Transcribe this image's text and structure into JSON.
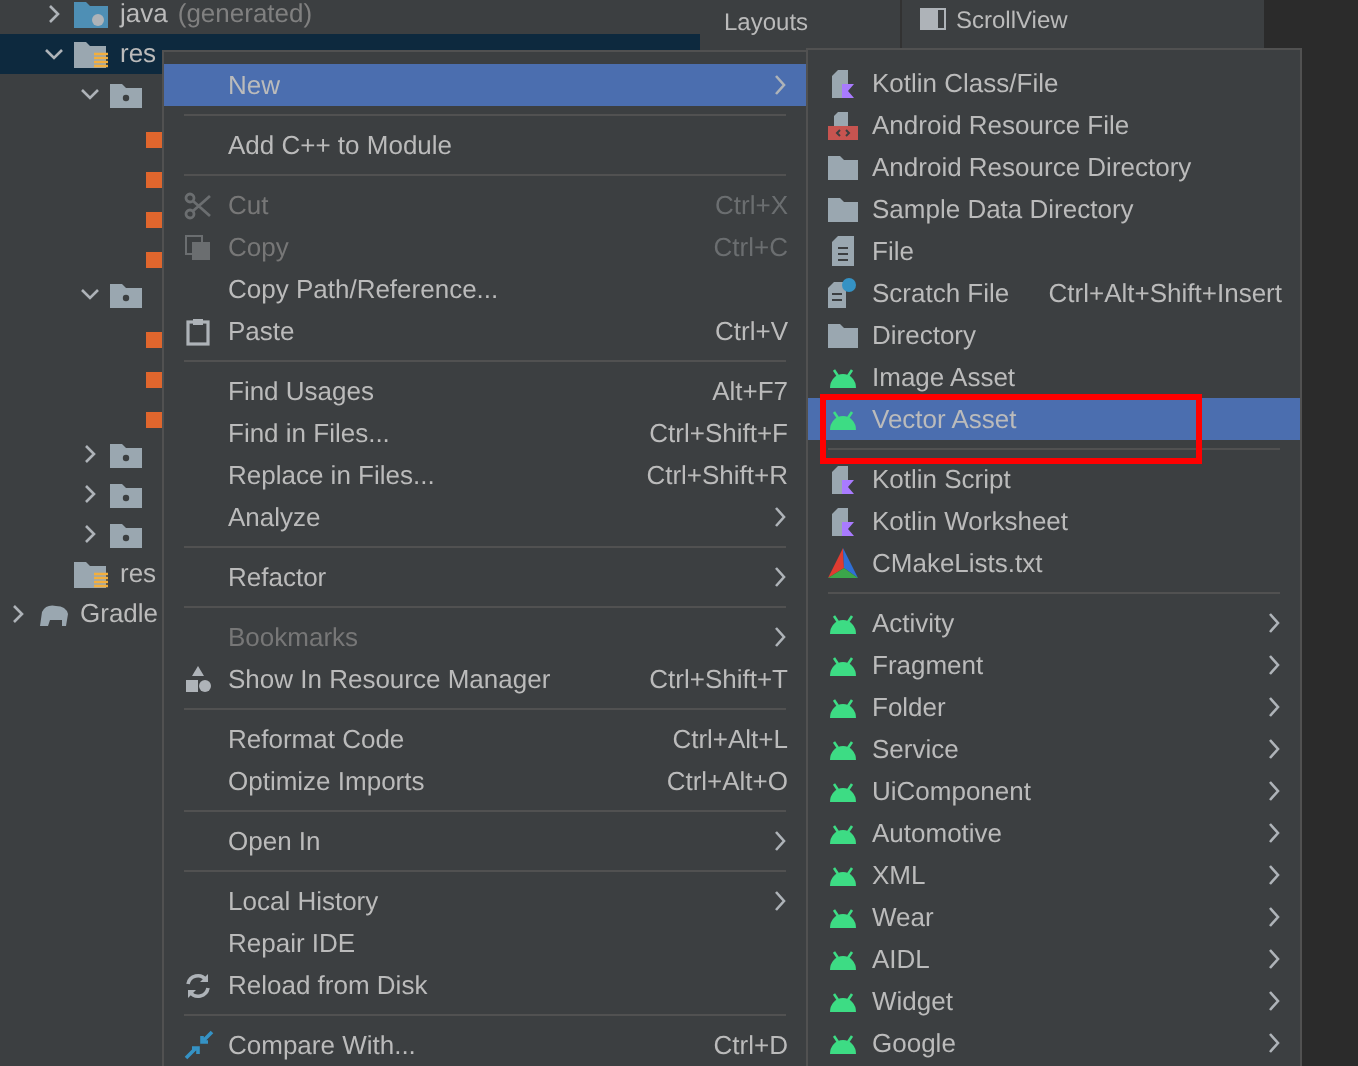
{
  "project_tree": {
    "items": [
      {
        "kind": "generated",
        "label": "java",
        "note": "(generated)",
        "expanded": false,
        "selected": false
      },
      {
        "kind": "res",
        "label": "res",
        "expanded": true,
        "selected": true,
        "children": [
          {
            "kind": "folder",
            "expanded": true,
            "selected": false,
            "children": [
              {
                "kind": "file",
                "selected": false
              },
              {
                "kind": "file",
                "selected": false
              },
              {
                "kind": "file",
                "selected": false
              },
              {
                "kind": "file",
                "selected": false
              }
            ]
          },
          {
            "kind": "folder",
            "expanded": true,
            "selected": false,
            "children": [
              {
                "kind": "file",
                "selected": false
              },
              {
                "kind": "file",
                "selected": false
              },
              {
                "kind": "file",
                "selected": false
              }
            ]
          },
          {
            "kind": "folder",
            "expanded": false,
            "selected": false
          },
          {
            "kind": "folder",
            "expanded": false,
            "selected": false
          },
          {
            "kind": "folder",
            "expanded": false,
            "selected": false
          }
        ]
      },
      {
        "kind": "res",
        "label": "res",
        "selected": false
      },
      {
        "kind": "gradle",
        "label": "Gradle",
        "expanded": false,
        "selected": false
      }
    ]
  },
  "palette": {
    "category": "Layouts",
    "item": "ScrollView"
  },
  "context_menu": {
    "groups": [
      [
        {
          "label": "New",
          "selected": true,
          "submenu": true,
          "disabled": false
        }
      ],
      [
        {
          "label": "Add C++ to Module",
          "selected": false,
          "submenu": false,
          "disabled": false
        }
      ],
      [
        {
          "label": "Cut",
          "kind": "cut",
          "shortcut": "Ctrl+X",
          "selected": false,
          "submenu": false,
          "disabled": true
        },
        {
          "label": "Copy",
          "kind": "copy",
          "shortcut": "Ctrl+C",
          "selected": false,
          "submenu": false,
          "disabled": true
        },
        {
          "label": "Copy Path/Reference...",
          "selected": false,
          "submenu": false,
          "disabled": false
        },
        {
          "label": "Paste",
          "kind": "paste",
          "shortcut": "Ctrl+V",
          "selected": false,
          "submenu": false,
          "disabled": false
        }
      ],
      [
        {
          "label": "Find Usages",
          "shortcut": "Alt+F7",
          "selected": false,
          "submenu": false,
          "disabled": false
        },
        {
          "label": "Find in Files...",
          "shortcut": "Ctrl+Shift+F",
          "selected": false,
          "submenu": false,
          "disabled": false
        },
        {
          "label": "Replace in Files...",
          "shortcut": "Ctrl+Shift+R",
          "selected": false,
          "submenu": false,
          "disabled": false
        },
        {
          "label": "Analyze",
          "selected": false,
          "submenu": true,
          "disabled": false
        }
      ],
      [
        {
          "label": "Refactor",
          "selected": false,
          "submenu": true,
          "disabled": false
        }
      ],
      [
        {
          "label": "Bookmarks",
          "selected": false,
          "submenu": true,
          "disabled": true
        },
        {
          "label": "Show In Resource Manager",
          "kind": "shapes",
          "shortcut": "Ctrl+Shift+T",
          "selected": false,
          "submenu": false,
          "disabled": false
        }
      ],
      [
        {
          "label": "Reformat Code",
          "shortcut": "Ctrl+Alt+L",
          "selected": false,
          "submenu": false,
          "disabled": false
        },
        {
          "label": "Optimize Imports",
          "shortcut": "Ctrl+Alt+O",
          "selected": false,
          "submenu": false,
          "disabled": false
        }
      ],
      [
        {
          "label": "Open In",
          "selected": false,
          "submenu": true,
          "disabled": false
        }
      ],
      [
        {
          "label": "Local History",
          "selected": false,
          "submenu": true,
          "disabled": false
        },
        {
          "label": "Repair IDE",
          "selected": false,
          "submenu": false,
          "disabled": false
        },
        {
          "label": "Reload from Disk",
          "kind": "reload",
          "selected": false,
          "submenu": false,
          "disabled": false
        }
      ],
      [
        {
          "label": "Compare With...",
          "kind": "compare",
          "shortcut": "Ctrl+D",
          "selected": false,
          "submenu": false,
          "disabled": false
        }
      ]
    ]
  },
  "new_submenu": {
    "groups": [
      [
        {
          "label": "Kotlin Class/File",
          "kind": "kotlin",
          "selected": false,
          "submenu": false
        },
        {
          "label": "Android Resource File",
          "kind": "resource",
          "selected": false,
          "submenu": false
        },
        {
          "label": "Android Resource Directory",
          "kind": "folder",
          "selected": false,
          "submenu": false
        },
        {
          "label": "Sample Data Directory",
          "kind": "folder",
          "selected": false,
          "submenu": false
        },
        {
          "label": "File",
          "kind": "file",
          "selected": false,
          "submenu": false
        },
        {
          "label": "Scratch File",
          "kind": "scratch",
          "shortcut": "Ctrl+Alt+Shift+Insert",
          "selected": false,
          "submenu": false
        },
        {
          "label": "Directory",
          "kind": "folder",
          "selected": false,
          "submenu": false
        },
        {
          "label": "Image Asset",
          "kind": "android",
          "selected": false,
          "submenu": false
        },
        {
          "label": "Vector Asset",
          "kind": "android",
          "selected": true,
          "submenu": false
        }
      ],
      [
        {
          "label": "Kotlin Script",
          "kind": "kotlin",
          "selected": false,
          "submenu": false
        },
        {
          "label": "Kotlin Worksheet",
          "kind": "kotlin",
          "selected": false,
          "submenu": false
        },
        {
          "label": "CMakeLists.txt",
          "kind": "cmake",
          "selected": false,
          "submenu": false
        }
      ],
      [
        {
          "label": "Activity",
          "kind": "android",
          "selected": false,
          "submenu": true
        },
        {
          "label": "Fragment",
          "kind": "android",
          "selected": false,
          "submenu": true
        },
        {
          "label": "Folder",
          "kind": "android",
          "selected": false,
          "submenu": true
        },
        {
          "label": "Service",
          "kind": "android",
          "selected": false,
          "submenu": true
        },
        {
          "label": "UiComponent",
          "kind": "android",
          "selected": false,
          "submenu": true
        },
        {
          "label": "Automotive",
          "kind": "android",
          "selected": false,
          "submenu": true
        },
        {
          "label": "XML",
          "kind": "android",
          "selected": false,
          "submenu": true
        },
        {
          "label": "Wear",
          "kind": "android",
          "selected": false,
          "submenu": true
        },
        {
          "label": "AIDL",
          "kind": "android",
          "selected": false,
          "submenu": true
        },
        {
          "label": "Widget",
          "kind": "android",
          "selected": false,
          "submenu": true
        },
        {
          "label": "Google",
          "kind": "android",
          "selected": false,
          "submenu": true
        }
      ]
    ]
  }
}
